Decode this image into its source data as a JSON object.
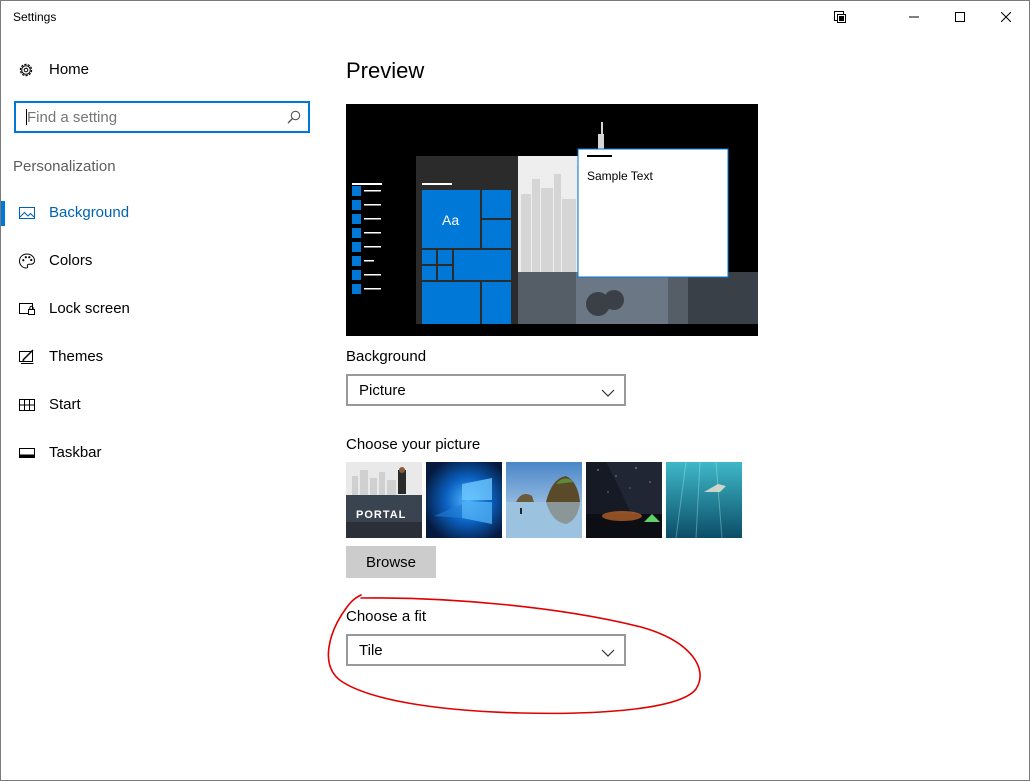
{
  "window": {
    "title": "Settings"
  },
  "sidebar": {
    "home_label": "Home",
    "search_placeholder": "Find a setting",
    "section_label": "Personalization",
    "items": [
      {
        "label": "Background",
        "icon": "image-icon",
        "active": true
      },
      {
        "label": "Colors",
        "icon": "palette-icon",
        "active": false
      },
      {
        "label": "Lock screen",
        "icon": "lock-screen-icon",
        "active": false
      },
      {
        "label": "Themes",
        "icon": "themes-icon",
        "active": false
      },
      {
        "label": "Start",
        "icon": "start-icon",
        "active": false
      },
      {
        "label": "Taskbar",
        "icon": "taskbar-icon",
        "active": false
      }
    ]
  },
  "main": {
    "heading": "Preview",
    "preview": {
      "tile_label": "Aa",
      "sample_text": "Sample Text"
    },
    "background": {
      "label": "Background",
      "value": "Picture"
    },
    "choose_picture": {
      "label": "Choose your picture",
      "thumbnails": [
        {
          "name": "portal-wallpaper",
          "text": "PORTAL"
        },
        {
          "name": "windows-10-wallpaper"
        },
        {
          "name": "beach-rocks-wallpaper"
        },
        {
          "name": "night-sky-tent-wallpaper"
        },
        {
          "name": "underwater-swimmer-wallpaper"
        }
      ],
      "browse_label": "Browse"
    },
    "fit": {
      "label": "Choose a fit",
      "value": "Tile"
    }
  },
  "colors": {
    "accent": "#0078d7",
    "annotation": "#e00000"
  }
}
